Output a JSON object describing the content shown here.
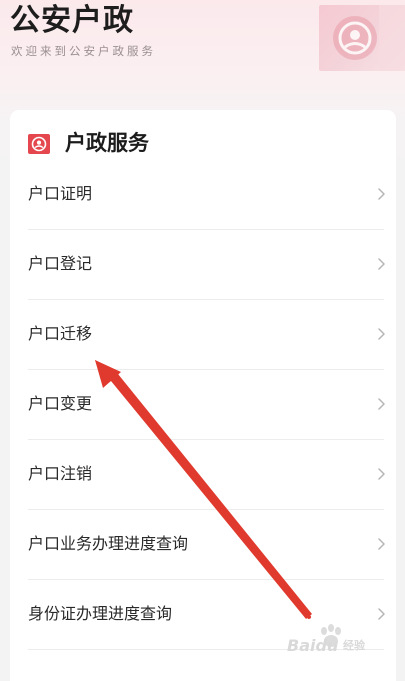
{
  "header": {
    "title": "公安户政",
    "subtitle": "欢迎来到公安户政服务",
    "art_icon": "police-emblem-icon"
  },
  "section": {
    "title": "户政服务",
    "icon": "police-emblem-icon",
    "accent_color": "#e4474d"
  },
  "menu": {
    "items": [
      {
        "label": "户口证明"
      },
      {
        "label": "户口登记"
      },
      {
        "label": "户口迁移"
      },
      {
        "label": "户口变更"
      },
      {
        "label": "户口注销"
      },
      {
        "label": "户口业务办理进度查询"
      },
      {
        "label": "身份证办理进度查询"
      }
    ],
    "chevron_icon": "chevron-right-icon"
  },
  "annotation": {
    "color": "#e03a2e",
    "target": "户口迁移"
  },
  "watermark": {
    "text": "Baidu",
    "sub": "经验",
    "icon": "baidu-paw-icon"
  }
}
